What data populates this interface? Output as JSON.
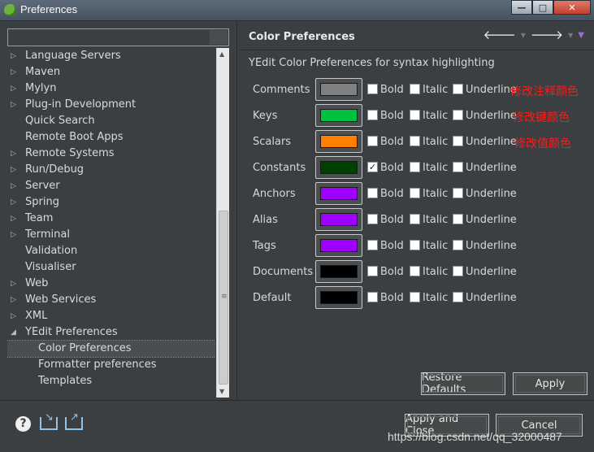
{
  "window": {
    "title": "Preferences",
    "controls": {
      "minimize": "—",
      "maximize": "□",
      "close": "✕"
    }
  },
  "left": {
    "filter": {
      "value": "",
      "placeholder": ""
    },
    "tree": [
      {
        "label": "Language Servers",
        "arrow": "▷",
        "child": false
      },
      {
        "label": "Maven",
        "arrow": "▷",
        "child": false
      },
      {
        "label": "Mylyn",
        "arrow": "▷",
        "child": false
      },
      {
        "label": "Plug-in Development",
        "arrow": "▷",
        "child": false
      },
      {
        "label": "Quick Search",
        "arrow": "",
        "child": false
      },
      {
        "label": "Remote Boot Apps",
        "arrow": "",
        "child": false
      },
      {
        "label": "Remote Systems",
        "arrow": "▷",
        "child": false
      },
      {
        "label": "Run/Debug",
        "arrow": "▷",
        "child": false
      },
      {
        "label": "Server",
        "arrow": "▷",
        "child": false
      },
      {
        "label": "Spring",
        "arrow": "▷",
        "child": false
      },
      {
        "label": "Team",
        "arrow": "▷",
        "child": false
      },
      {
        "label": "Terminal",
        "arrow": "▷",
        "child": false
      },
      {
        "label": "Validation",
        "arrow": "",
        "child": false
      },
      {
        "label": "Visualiser",
        "arrow": "",
        "child": false
      },
      {
        "label": "Web",
        "arrow": "▷",
        "child": false
      },
      {
        "label": "Web Services",
        "arrow": "▷",
        "child": false
      },
      {
        "label": "XML",
        "arrow": "▷",
        "child": false
      },
      {
        "label": "YEdit Preferences",
        "arrow": "◢",
        "child": false
      },
      {
        "label": "Color Preferences",
        "arrow": "",
        "child": true,
        "selected": true
      },
      {
        "label": "Formatter preferences",
        "arrow": "",
        "child": true
      },
      {
        "label": "Templates",
        "arrow": "",
        "child": true
      }
    ]
  },
  "page": {
    "title": "Color Preferences",
    "description": "YEdit Color Preferences for syntax highlighting",
    "checkbox_labels": {
      "bold": "Bold",
      "italic": "Italic",
      "underline": "Underline"
    },
    "rows": [
      {
        "name": "Comments",
        "color": "#808080",
        "bold": false,
        "italic": false,
        "underline": false,
        "note": "修改注释颜色"
      },
      {
        "name": "Keys",
        "color": "#00c040",
        "bold": false,
        "italic": false,
        "underline": false,
        "note": "修改键颜色"
      },
      {
        "name": "Scalars",
        "color": "#ff8000",
        "bold": false,
        "italic": false,
        "underline": false,
        "note": "修改值颜色"
      },
      {
        "name": "Constants",
        "color": "#004000",
        "bold": true,
        "italic": false,
        "underline": false,
        "note": ""
      },
      {
        "name": "Anchors",
        "color": "#a000ff",
        "bold": false,
        "italic": false,
        "underline": false,
        "note": ""
      },
      {
        "name": "Alias",
        "color": "#a000ff",
        "bold": false,
        "italic": false,
        "underline": false,
        "note": ""
      },
      {
        "name": "Tags",
        "color": "#a000ff",
        "bold": false,
        "italic": false,
        "underline": false,
        "note": ""
      },
      {
        "name": "Documents",
        "color": "#000000",
        "bold": false,
        "italic": false,
        "underline": false,
        "note": ""
      },
      {
        "name": "Default",
        "color": "#000000",
        "bold": false,
        "italic": false,
        "underline": false,
        "note": ""
      }
    ],
    "buttons": {
      "restore_defaults": "Restore Defaults",
      "apply": "Apply"
    }
  },
  "bottom": {
    "apply_and_close": "Apply and Close",
    "cancel": "Cancel",
    "watermark": "https://blog.csdn.net/qq_32000487"
  },
  "colors": {
    "note_red": "#ff1a1a",
    "background": "#3c3f41"
  },
  "icons": [
    "help-icon",
    "import-icon",
    "export-icon",
    "back-arrow-icon",
    "forward-arrow-icon",
    "view-menu-icon",
    "spring-app-icon"
  ]
}
